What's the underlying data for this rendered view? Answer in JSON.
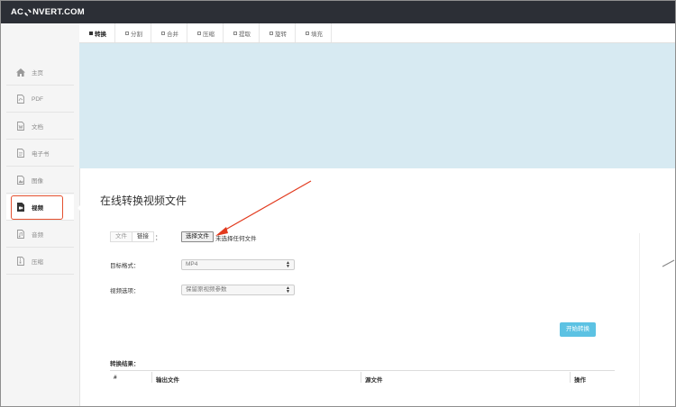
{
  "app": {
    "logo_left": "AC",
    "logo_right": "NVERT.COM"
  },
  "sidebar": {
    "items": [
      {
        "label": "主页",
        "icon": "home-icon"
      },
      {
        "label": "PDF",
        "icon": "pdf-file-icon"
      },
      {
        "label": "文档",
        "icon": "document-icon"
      },
      {
        "label": "电子书",
        "icon": "ebook-icon"
      },
      {
        "label": "图像",
        "icon": "image-icon"
      },
      {
        "label": "视频",
        "icon": "video-icon",
        "active": true
      },
      {
        "label": "音频",
        "icon": "audio-icon"
      },
      {
        "label": "压缩",
        "icon": "archive-icon"
      }
    ]
  },
  "tabs": [
    "转换",
    "分割",
    "合并",
    "压缩",
    "提取",
    "旋转",
    "填充"
  ],
  "main": {
    "title": "在线转换视频文件",
    "source_toggle": {
      "file": "文件",
      "link": "链接",
      "colon": "："
    },
    "file_input": {
      "button": "选择文件",
      "status": "未选择任何文件"
    },
    "target_format": {
      "label": "目标格式：",
      "value": "MP4"
    },
    "video_options": {
      "label": "视频选项：",
      "value": "保留原视频参数"
    },
    "start_button": "开始转换",
    "results": {
      "label": "转换结果：",
      "columns": [
        "#",
        "输出文件",
        "源文件",
        "操作"
      ]
    }
  },
  "colors": {
    "topbar": "#2c2f36",
    "banner": "#d7eaf2",
    "accent": "#5cc2e3",
    "highlight": "#e4502f"
  }
}
